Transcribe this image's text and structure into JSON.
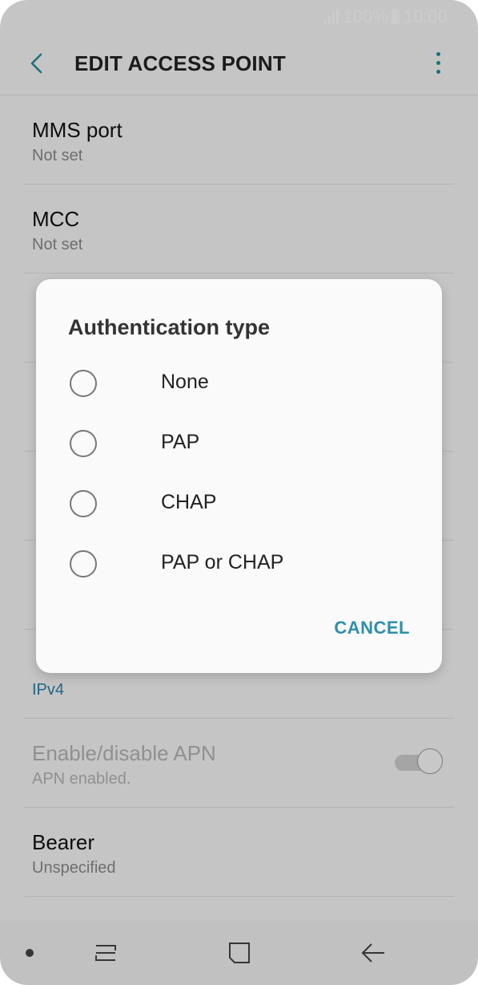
{
  "status_bar": {
    "battery_percent": "100%",
    "time": "10:00"
  },
  "app_bar": {
    "title": "EDIT ACCESS POINT"
  },
  "settings": [
    {
      "title": "MMS port",
      "subtitle": "Not set"
    },
    {
      "title": "MCC",
      "subtitle": "Not set"
    },
    {
      "title": "",
      "subtitle": ""
    },
    {
      "title": "",
      "subtitle": ""
    },
    {
      "title": "",
      "subtitle": ""
    },
    {
      "title": "",
      "subtitle": ""
    },
    {
      "title": "",
      "subtitle": "IPv4"
    },
    {
      "title": "Enable/disable APN",
      "subtitle": "APN enabled.",
      "toggle_on": true
    },
    {
      "title": "Bearer",
      "subtitle": "Unspecified"
    }
  ],
  "dialog": {
    "title": "Authentication type",
    "options": [
      "None",
      "PAP",
      "CHAP",
      "PAP or CHAP"
    ],
    "selected_index": null,
    "cancel_label": "CANCEL"
  },
  "colors": {
    "accent": "#2f8fa8",
    "subtitle_blue": "#2a7fa8",
    "scrim": "rgba(0,0,0,0.2)"
  },
  "icons": {
    "back": "chevron-left-icon",
    "more": "more-vertical-icon",
    "nav_recents": "recents-icon",
    "nav_home": "home-icon",
    "nav_back": "back-arrow-icon"
  }
}
